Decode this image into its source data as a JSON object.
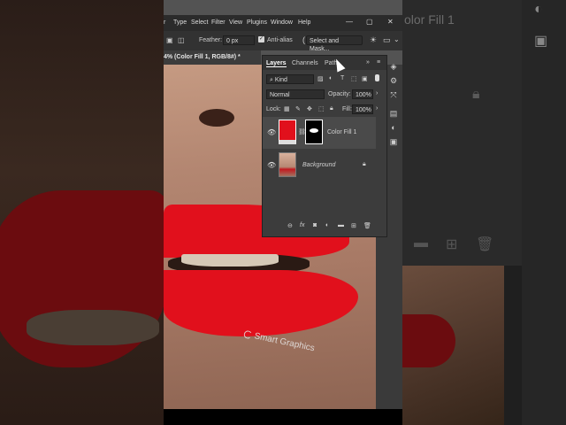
{
  "menubar": {
    "items": [
      "r",
      "Type",
      "Select",
      "Filter",
      "View",
      "Plugins",
      "Window",
      "Help"
    ],
    "window_controls": [
      "—",
      "▢",
      "✕"
    ]
  },
  "options_bar": {
    "feather_label": "Feather:",
    "feather_value": "0 px",
    "antialias_label": "Anti-alias",
    "antialias_checked": true,
    "select_mask_label": "Select and Mask..."
  },
  "document_tab": {
    "title": "4% (Color Fill 1, RGB/8#) *"
  },
  "canvas": {
    "watermark": "Smart Graphics"
  },
  "layers_panel": {
    "tabs": [
      "Layers",
      "Channels",
      "Path"
    ],
    "active_tab": "Layers",
    "filter_kind": "Kind",
    "blend_mode": "Normal",
    "opacity_label": "Opacity:",
    "opacity_value": "100%",
    "lock_label": "Lock:",
    "fill_label": "Fill:",
    "fill_value": "100%",
    "layers": [
      {
        "name": "Color Fill 1",
        "visible": true,
        "selected": true,
        "fill_color": "#e1101c"
      },
      {
        "name": "Background",
        "visible": true,
        "selected": false,
        "locked": true
      }
    ],
    "footer_icons": [
      "link-icon",
      "fx-icon",
      "mask-icon",
      "adjustment-icon",
      "folder-icon",
      "new-layer-icon",
      "trash-icon"
    ]
  },
  "ghost_right": {
    "title": "olor Fill 1"
  },
  "colors": {
    "lip_red": "#e1101c",
    "panel_bg": "#3c3c3c",
    "selected_row": "#4a4a4a"
  }
}
